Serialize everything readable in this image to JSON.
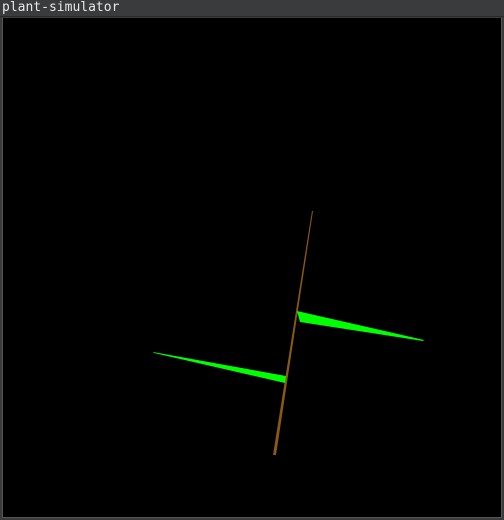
{
  "window": {
    "title": "plant-simulator"
  },
  "scene": {
    "background": "#000000",
    "stem_color": "#8b5a10",
    "leaf_color": "#00ff00",
    "stem": {
      "name": "stem"
    },
    "leaves": [
      {
        "name": "leaf-right"
      },
      {
        "name": "leaf-left"
      }
    ]
  }
}
